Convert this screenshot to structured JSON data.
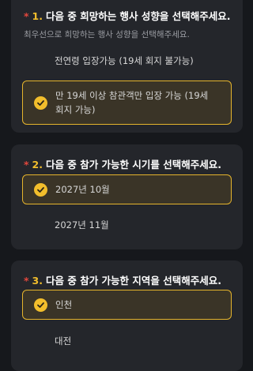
{
  "colors": {
    "background": "#16181c",
    "card": "#24262b",
    "accent": "#f2be2c",
    "required_star": "#e2473d",
    "selected_bg": "#3a3427"
  },
  "questions": [
    {
      "star": "*",
      "number": "1.",
      "title": "다음 중 희망하는 행사 성향을 선택해주세요.",
      "subtitle": "최우선으로 희망하는 행사 성향을 선택해주세요.",
      "options": [
        {
          "label": "전연령 입장가능 (19세 회지 불가능)",
          "selected": false
        },
        {
          "label": "만 19세 이상 참관객만 입장 가능 (19세 회지 가능)",
          "selected": true
        }
      ]
    },
    {
      "star": "*",
      "number": "2.",
      "title": "다음 중 참가 가능한 시기를 선택해주세요.",
      "options": [
        {
          "label": "2027년 10월",
          "selected": true
        },
        {
          "label": "2027년 11월",
          "selected": false
        }
      ]
    },
    {
      "star": "*",
      "number": "3.",
      "title": "다음 중 참가 가능한 지역을 선택해주세요.",
      "options": [
        {
          "label": "인천",
          "selected": true
        },
        {
          "label": "대전",
          "selected": false
        }
      ]
    }
  ]
}
